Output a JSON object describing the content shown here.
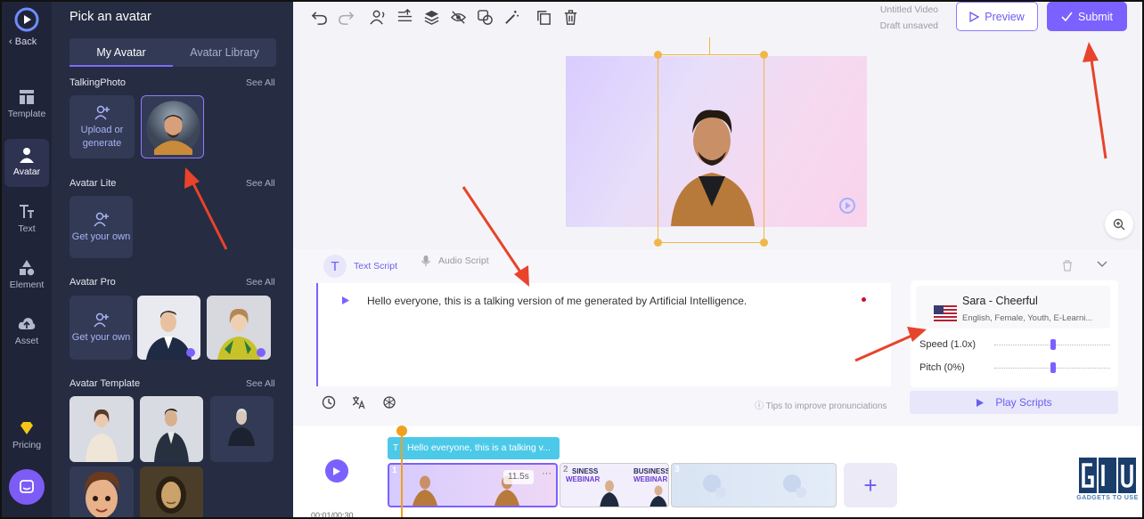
{
  "rail": {
    "back_label": "Back",
    "items": [
      {
        "label": "Template",
        "icon": "template-icon"
      },
      {
        "label": "Avatar",
        "icon": "avatar-icon",
        "active": true
      },
      {
        "label": "Text",
        "icon": "text-icon"
      },
      {
        "label": "Element",
        "icon": "element-icon"
      },
      {
        "label": "Asset",
        "icon": "asset-icon"
      }
    ],
    "pricing_label": "Pricing"
  },
  "panel": {
    "title": "Pick an avatar",
    "tabs": [
      "My Avatar",
      "Avatar Library"
    ],
    "see_all": "See All",
    "sections": {
      "talking_photo": "TalkingPhoto",
      "avatar_lite": "Avatar Lite",
      "avatar_pro": "Avatar Pro",
      "avatar_template": "Avatar Template"
    },
    "upload_label": "Upload or generate",
    "get_own_label": "Get your own"
  },
  "toolbar": {
    "video_title": "Untitled Video",
    "save_status": "Draft unsaved",
    "preview_label": "Preview",
    "submit_label": "Submit"
  },
  "script": {
    "text_tab": "Text Script",
    "audio_tab": "Audio Script",
    "text": "Hello everyone, this is a talking version of me generated by Artificial Intelligence.",
    "tips": "Tips to improve pronunciations"
  },
  "voice": {
    "name": "Sara - Cheerful",
    "description": "English, Female, Youth, E-Learni...",
    "speed_label": "Speed (1.0x)",
    "pitch_label": "Pitch (0%)",
    "speed_value": 1.0,
    "pitch_value": 0,
    "play_label": "Play Scripts"
  },
  "timeline": {
    "caption": "Hello everyone, this is a talking v...",
    "clip1_duration": "11.5s",
    "clip_numbers": [
      "1",
      "2",
      "3"
    ],
    "clip2_text1": "SINESS",
    "clip2_text2": "WEBINAR",
    "clip2_text3": "BUSINESS",
    "clip2_text4": "WEBINAR",
    "time_readout": "00:01/00:30",
    "add_label": "+"
  },
  "watermark": {
    "text": "GADGETS TO USE"
  },
  "colors": {
    "accent": "#7b61ff",
    "sidebar": "#262c42",
    "annotation": "#e8432b"
  }
}
